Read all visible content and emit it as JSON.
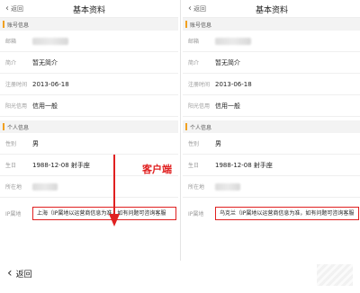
{
  "left": {
    "nav": {
      "back": "返回",
      "title": "基本资料"
    },
    "account_section": "账号信息",
    "email_label": "邮箱",
    "intro_label": "简介",
    "intro_value": "暂无简介",
    "register_label": "注册时间",
    "register_value": "2013-06-18",
    "credit_label": "阳光信用",
    "credit_value": "信用一般",
    "personal_section": "个人信息",
    "gender_label": "性别",
    "gender_value": "男",
    "birthday_label": "生日",
    "birthday_value": "1988-12-08 射手座",
    "location_label": "所在地",
    "ip_label": "IP属地",
    "ip_value": "上海（IP属地以运营商信息为准，如有问题可咨询客服"
  },
  "right": {
    "nav": {
      "back": "返回",
      "title": "基本资料"
    },
    "account_section": "账号信息",
    "email_label": "邮箱",
    "intro_label": "简介",
    "intro_value": "暂无简介",
    "register_label": "注册时间",
    "register_value": "2013-06-18",
    "credit_label": "阳光信用",
    "credit_value": "信用一般",
    "personal_section": "个人信息",
    "gender_label": "性别",
    "gender_value": "男",
    "birthday_label": "生日",
    "birthday_value": "1988-12-08 射手座",
    "location_label": "所在地",
    "ip_label": "IP属地",
    "ip_value": "乌克兰（IP属地以运营商信息为准，如有问题可咨询客服"
  },
  "annotation": {
    "label": "客户端",
    "color": "#e02020"
  },
  "bottom": {
    "back": "返回"
  },
  "colors": {
    "section_accent": "#f0a020",
    "highlight_border": "#e02020"
  }
}
